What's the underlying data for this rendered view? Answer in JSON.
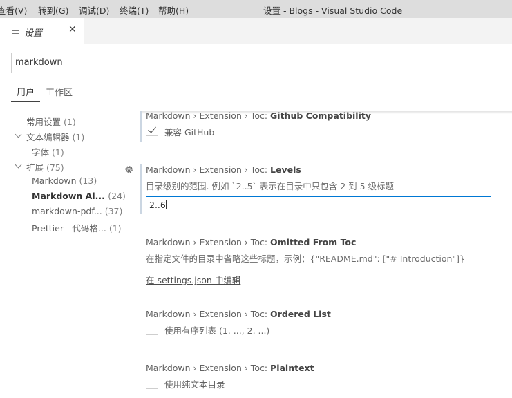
{
  "menubar": {
    "items": [
      {
        "text": "查看(",
        "mnemonic": "V",
        "end": ")"
      },
      {
        "text": "转到(",
        "mnemonic": "G",
        "end": ")"
      },
      {
        "text": "调试(",
        "mnemonic": "D",
        "end": ")"
      },
      {
        "text": "终端(",
        "mnemonic": "T",
        "end": ")"
      },
      {
        "text": "帮助(",
        "mnemonic": "H",
        "end": ")"
      }
    ]
  },
  "window": {
    "title": "设置 - Blogs - Visual Studio Code"
  },
  "tab": {
    "label": "设置",
    "close": "✕",
    "icon": "list-icon"
  },
  "search": {
    "value": "markdown"
  },
  "scope": {
    "user": "用户",
    "workspace": "工作区"
  },
  "toc": [
    {
      "label": "常用设置",
      "count": "(1)"
    },
    {
      "label": "文本编辑器",
      "count": "(1)"
    },
    {
      "label": "字体",
      "count": "(1)"
    },
    {
      "label": "扩展",
      "count": "(75)"
    },
    {
      "label": "Markdown",
      "count": "(13)"
    },
    {
      "label": "Markdown Al...",
      "count": "(24)"
    },
    {
      "label": "markdown-pdf...",
      "count": "(37)"
    },
    {
      "label": "Prettier - 代码格...",
      "count": "(1)"
    }
  ],
  "settings": {
    "github": {
      "prefix": "Markdown › Extension › Toc: ",
      "name": "Github Compatibility",
      "checkbox_label": "兼容 GitHub",
      "checked": true
    },
    "levels": {
      "prefix": "Markdown › Extension › Toc: ",
      "name": "Levels",
      "description": "目录级别的范围. 例如 `2..5` 表示在目录中只包含 2 到 5 级标题",
      "value": "2..6"
    },
    "omitted": {
      "prefix": "Markdown › Extension › Toc: ",
      "name": "Omitted From Toc",
      "description": "在指定文件的目录中省略这些标题，示例：{\"README.md\": [\"# Introduction\"]}",
      "link": "在 settings.json 中编辑"
    },
    "ordered": {
      "prefix": "Markdown › Extension › Toc: ",
      "name": "Ordered List",
      "checkbox_label": "使用有序列表 (1. ..., 2. ...)",
      "checked": false
    },
    "plaintext": {
      "prefix": "Markdown › Extension › Toc: ",
      "name": "Plaintext",
      "checkbox_label": "使用纯文本目录",
      "checked": false
    }
  },
  "colors": {
    "accent": "#0078d4",
    "titlebar": "#dddddd"
  }
}
